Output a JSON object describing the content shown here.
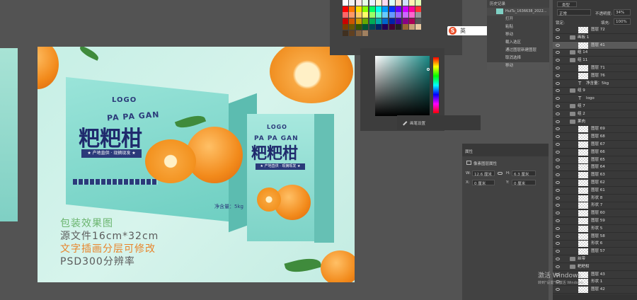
{
  "swatches": {
    "colors": [
      "#ffffff",
      "#f2f2f2",
      "#ffe8e8",
      "#e6ffe6",
      "#e8f0ff",
      "#fff8d0",
      "#ffd9f0",
      "#d9fff8",
      "#ffe0c0",
      "#d0e0ff",
      "#fff0b3",
      "#e0ffb3",
      "#ff0000",
      "#ff7700",
      "#ffdd00",
      "#88ff00",
      "#00ff66",
      "#00ffee",
      "#0099ff",
      "#0033ff",
      "#6600ff",
      "#cc00ff",
      "#ff0099",
      "#ff3333",
      "#ff6666",
      "#ff9966",
      "#ffcc66",
      "#ffff66",
      "#99ff66",
      "#66ffcc",
      "#66ccff",
      "#6699ff",
      "#9966ff",
      "#cc66ff",
      "#ff66cc",
      "#999999",
      "#cc0000",
      "#cc5500",
      "#cc9900",
      "#66aa00",
      "#00aa55",
      "#00aaaa",
      "#0066cc",
      "#0022aa",
      "#4400aa",
      "#880088",
      "#aa0055",
      "#555555",
      "#7a3d00",
      "#665500",
      "#335500",
      "#005533",
      "#004455",
      "#002266",
      "#220055",
      "#440033",
      "#222222",
      "#996633",
      "#c8a27a",
      "#e6c8a0",
      "#403020",
      "#604020",
      "#806040",
      "#a08060"
    ]
  },
  "history": {
    "title": "历史记录",
    "snapshot": "HuiTu_1636638_2022...",
    "items": [
      "打开",
      "粘贴",
      "移动",
      "载入选区",
      "通过图层新建图层",
      "取消选择",
      "移动"
    ]
  },
  "ime": {
    "label": "英"
  },
  "brushsettings": {
    "label": "画笔设置"
  },
  "properties": {
    "title": "属性",
    "subtitle": "像素图层属性",
    "w_label": "W:",
    "w_val": "12.6 厘米",
    "h_label": "H:",
    "h_val": "6.3 厘米",
    "x_label": "X:",
    "x_val": "0 厘米",
    "y_label": "Y:",
    "y_val": "0 厘米"
  },
  "layers": {
    "kind": "类型",
    "blend": "正常",
    "opacity_label": "不透明度:",
    "opacity": "34%",
    "lock_label": "锁定:",
    "fill_label": "填充:",
    "fill": "100%",
    "rows": [
      {
        "name": "图层 72",
        "type": "layer"
      },
      {
        "name": "画板 1",
        "type": "folder"
      },
      {
        "name": "图层 41",
        "type": "layer",
        "selected": true
      },
      {
        "name": "组 14",
        "type": "folder"
      },
      {
        "name": "组 11",
        "type": "folder"
      },
      {
        "name": "图层 71",
        "type": "layer"
      },
      {
        "name": "图层 76",
        "type": "layer"
      },
      {
        "name": "净含量：5kg",
        "type": "text"
      },
      {
        "name": "组 9",
        "type": "folder"
      },
      {
        "name": "logo",
        "type": "text"
      },
      {
        "name": "组 7",
        "type": "folder"
      },
      {
        "name": "组 2",
        "type": "folder"
      },
      {
        "name": "果肉",
        "type": "folder"
      },
      {
        "name": "图层 69",
        "type": "layer"
      },
      {
        "name": "图层 68",
        "type": "layer"
      },
      {
        "name": "图层 67",
        "type": "layer"
      },
      {
        "name": "图层 66",
        "type": "layer"
      },
      {
        "name": "图层 65",
        "type": "layer"
      },
      {
        "name": "图层 64",
        "type": "layer"
      },
      {
        "name": "图层 63",
        "type": "layer"
      },
      {
        "name": "图层 62",
        "type": "layer"
      },
      {
        "name": "图层 61",
        "type": "layer"
      },
      {
        "name": "形状 8",
        "type": "layer"
      },
      {
        "name": "形状 7",
        "type": "layer"
      },
      {
        "name": "图层 60",
        "type": "layer"
      },
      {
        "name": "图层 59",
        "type": "layer"
      },
      {
        "name": "形状 5",
        "type": "layer"
      },
      {
        "name": "图层 58",
        "type": "layer"
      },
      {
        "name": "形状 6",
        "type": "layer"
      },
      {
        "name": "图层 57",
        "type": "layer"
      },
      {
        "name": "丝带",
        "type": "folder"
      },
      {
        "name": "粑粑柑",
        "type": "folder"
      },
      {
        "name": "图层 43",
        "type": "layer"
      },
      {
        "name": "形状 1",
        "type": "layer"
      },
      {
        "name": "图层 42",
        "type": "layer"
      }
    ]
  },
  "canvas": {
    "box_logo": "LOGO",
    "box_pinyin": "PA PA GAN",
    "box_title": "粑粑柑",
    "box_banner": "★ 产地直供 · 现摘现发 ★",
    "box_net": "净含量：5kg",
    "small_logo": "LOGO",
    "small_pinyin": "PA PA GAN",
    "small_title": "粑粑柑",
    "small_banner": "★ 产地直供 · 现摘现发 ★",
    "info1": "包装效果图",
    "info2": "源文件16cm*32cm",
    "info3": "文字插画分层可修改",
    "info4": "PSD300分辨率",
    "info1_color": "#6bb56f",
    "info2_color": "#5b5b5b",
    "info3_color": "#e8842a",
    "info4_color": "#5b5b5b"
  },
  "watermark": {
    "line1": "激活 Windows",
    "line2": "转到\"设置\"以激活 Windows。"
  }
}
